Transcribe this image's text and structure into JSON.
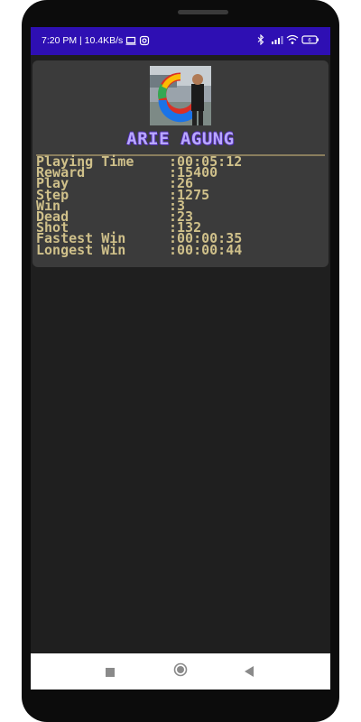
{
  "status_bar": {
    "time_net": "7:20 PM | 10.4KB/s",
    "icons": [
      "screen-icon",
      "instagram-icon",
      "bluetooth-icon",
      "signal-icon",
      "wifi-icon",
      "battery-icon"
    ]
  },
  "profile": {
    "name": "ARIE AGUNG"
  },
  "stats": [
    {
      "label": "Playing Time",
      "value": ":00:05:12"
    },
    {
      "label": "Reward",
      "value": ":15400"
    },
    {
      "label": "Play",
      "value": ":26"
    },
    {
      "label": "Step",
      "value": ":1275"
    },
    {
      "label": "Win",
      "value": ":3"
    },
    {
      "label": "Dead",
      "value": ":23"
    },
    {
      "label": "Shot",
      "value": ":132"
    },
    {
      "label": "Fastest Win",
      "value": ":00:00:35"
    },
    {
      "label": "Longest Win",
      "value": ":00:00:44"
    }
  ],
  "nav_bar": {
    "buttons": [
      "recent-apps-icon",
      "home-icon",
      "back-icon"
    ]
  },
  "colors": {
    "status_bar": "#2e0fb3",
    "card": "#3b3b3b",
    "stats_text": "#cfc08a",
    "name_text": "#b9a7ff"
  }
}
